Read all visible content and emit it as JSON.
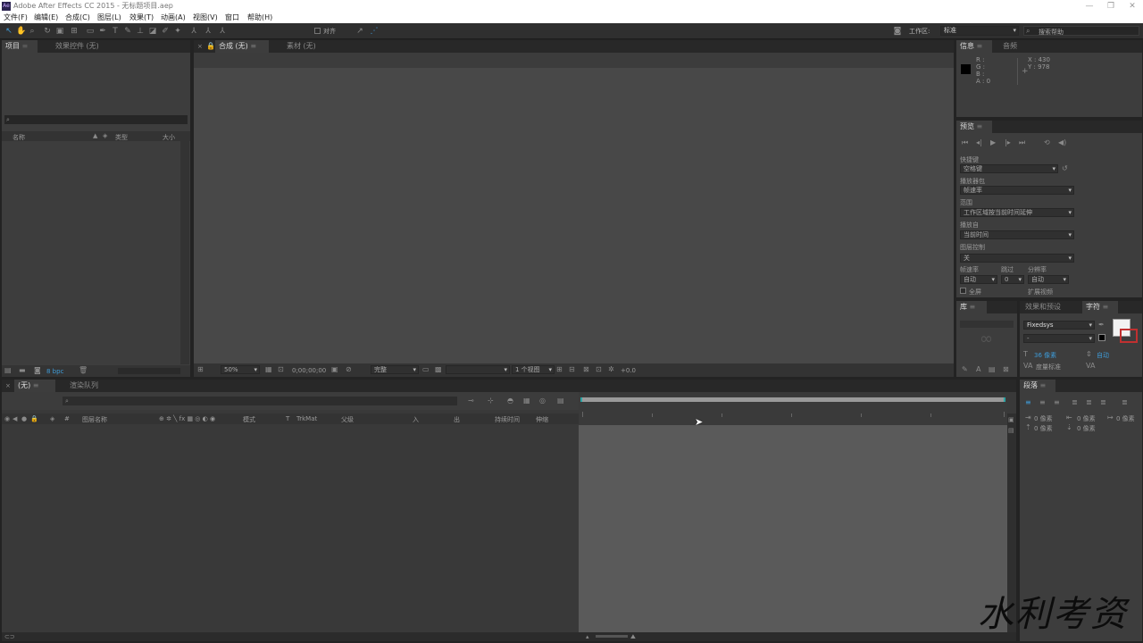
{
  "title": "Adobe After Effects CC 2015 - 无标题项目.aep",
  "menu": [
    "文件(F)",
    "编辑(E)",
    "合成(C)",
    "图层(L)",
    "效果(T)",
    "动画(A)",
    "视图(V)",
    "窗口",
    "帮助(H)"
  ],
  "toolbar": {
    "align_label": "对齐",
    "workspace_label": "工作区:",
    "workspace_value": "标准",
    "search_placeholder": "搜索帮助"
  },
  "project_panel": {
    "tabs": [
      "项目",
      "效果控件 (无)"
    ],
    "columns": [
      "名称",
      "类型",
      "大小"
    ],
    "footer_bpc": "8 bpc"
  },
  "comp_panel": {
    "tabs": [
      "合成 (无)",
      "素材 (无)"
    ],
    "zoom": "50%",
    "timecode": "0;00;00;00",
    "resolution": "完整",
    "views": "1 个视图",
    "exposure": "+0.0"
  },
  "info_panel": {
    "tabs": [
      "信息",
      "音频"
    ],
    "r": "R :",
    "g": "G :",
    "b": "B :",
    "a": "A : 0",
    "x": "X : 430",
    "y": "Y : 978"
  },
  "preview_panel": {
    "title": "预览",
    "shortcut_label": "快捷键",
    "shortcut_value": "空格键",
    "include_label": "播放器包",
    "include_value": "帧速率",
    "range_label": "范围",
    "range_value": "工作区域按当前时间延伸",
    "playfrom_label": "播放自",
    "playfrom_value": "当前时间",
    "layercontrol_label": "图层控制",
    "layercontrol_value": "关",
    "framerate_label": "帧速率",
    "skip_label": "跳过",
    "resolution_label": "分辨率",
    "framerate_value": "自动",
    "skip_value": "0",
    "resolution_value": "自动",
    "fullscreen_label": "全屏",
    "cache_label": "扩展视频"
  },
  "library_panel": {
    "tabs": [
      "库",
      "效果和预设",
      "字符"
    ]
  },
  "character_panel": {
    "font": "Fixedsys",
    "style": "-",
    "size": "36 像素",
    "leading": "自动",
    "kerning": "度量标准"
  },
  "paragraph_panel": {
    "title": "段落",
    "indent1": "0 像素",
    "indent2": "0 像素",
    "indent3": "0 像素",
    "space1": "0 像素",
    "space2": "0 像素"
  },
  "timeline": {
    "tabs": [
      "(无)",
      "渲染队列"
    ],
    "columns": {
      "layer_name": "图层名称",
      "mode": "模式",
      "trkmat": "TrkMat",
      "parent": "父级",
      "in": "入",
      "out": "出",
      "duration": "持续时间",
      "stretch": "伸缩"
    }
  },
  "watermark": "水利考资"
}
